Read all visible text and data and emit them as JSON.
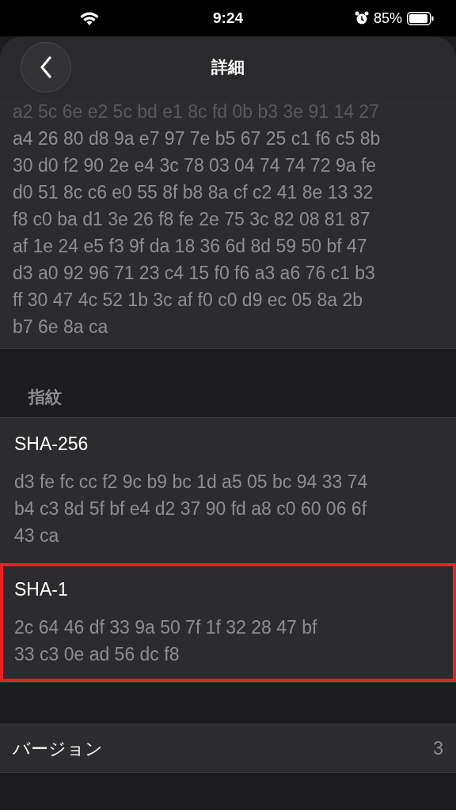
{
  "status_bar": {
    "time": "9:24",
    "battery": "85%"
  },
  "nav": {
    "title": "詳細"
  },
  "public_key": {
    "lines": [
      {
        "text": "a2 5c 6e e2 5c bd e1 8c fd 0b b3 3e 91 14 27",
        "faded": true
      },
      {
        "text": "a4 26 80 d8 9a e7 97 7e b5 67 25 c1 f6 c5 8b",
        "faded": false
      },
      {
        "text": "30 d0 f2 90 2e e4 3c 78 03 04 74 74 72 9a fe",
        "faded": false
      },
      {
        "text": "d0 51 8c c6 e0 55 8f b8 8a cf c2 41 8e 13 32",
        "faded": false
      },
      {
        "text": "f8 c0 ba d1 3e 26 f8 fe 2e 75 3c 82 08 81 87",
        "faded": false
      },
      {
        "text": "af 1e 24 e5 f3 9f da 18 36 6d 8d 59 50 bf 47",
        "faded": false
      },
      {
        "text": "d3 a0 92 96 71 23 c4 15 f0 f6 a3 a6 76 c1 b3",
        "faded": false
      },
      {
        "text": "ff 30 47 4c 52 1b 3c af f0 c0 d9 ec 05 8a 2b",
        "faded": false
      },
      {
        "text": "b7 6e 8a ca",
        "faded": false
      }
    ]
  },
  "fingerprints": {
    "header": "指紋",
    "items": [
      {
        "label": "SHA-256",
        "lines": [
          "d3 fe fc cc f2 9c b9 bc 1d a5 05 bc 94 33 74",
          "b4 c3 8d 5f bf e4 d2 37 90 fd a8 c0 60 06 6f",
          "43 ca"
        ],
        "highlighted": false
      },
      {
        "label": "SHA-1",
        "lines": [
          "2c 64 46 df 33 9a 50 7f 1f 32 28 47 bf",
          "33 c3 0e ad 56 dc f8"
        ],
        "highlighted": true
      }
    ]
  },
  "version": {
    "label": "バージョン",
    "value": "3"
  }
}
